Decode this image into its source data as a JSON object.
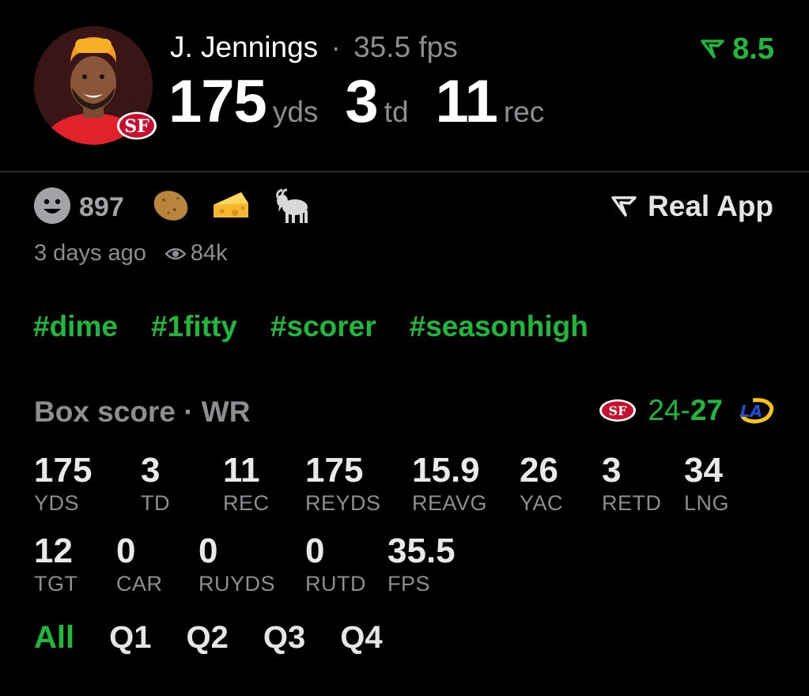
{
  "player": {
    "name": "J. Jennings",
    "separator": "·",
    "fps_text": "35.5 fps",
    "headline": [
      {
        "value": "175",
        "unit": "yds"
      },
      {
        "value": "3",
        "unit": "td"
      },
      {
        "value": "11",
        "unit": "rec"
      }
    ],
    "team_logo_text": "SF"
  },
  "rating": {
    "value": "8.5",
    "color": "#1fb83b"
  },
  "reactions": {
    "count": "897",
    "emojis": [
      "smiley-face-icon",
      "potato-icon",
      "cheese-icon",
      "goat-icon"
    ]
  },
  "source": {
    "label": "Real App"
  },
  "meta": {
    "time_ago": "3 days ago",
    "views": "84k"
  },
  "hashtags": [
    "#dime",
    "#1fitty",
    "#scorer",
    "#seasonhigh"
  ],
  "box_score": {
    "title": "Box score · WR",
    "home_logo_text": "SF",
    "away_logo_text": "LA",
    "score_left": "24-",
    "score_right": "27",
    "stats_row1": [
      {
        "value": "175",
        "label": "YDS"
      },
      {
        "value": "3",
        "label": "TD"
      },
      {
        "value": "11",
        "label": "REC"
      },
      {
        "value": "175",
        "label": "REYDS"
      },
      {
        "value": "15.9",
        "label": "REAVG"
      },
      {
        "value": "26",
        "label": "YAC"
      },
      {
        "value": "3",
        "label": "RETD"
      },
      {
        "value": "34",
        "label": "LNG"
      }
    ],
    "stats_row2": [
      {
        "value": "12",
        "label": "TGT"
      },
      {
        "value": "0",
        "label": "CAR"
      },
      {
        "value": "0",
        "label": "RUYDS"
      },
      {
        "value": "0",
        "label": "RUTD"
      },
      {
        "value": "35.5",
        "label": "FPS"
      }
    ]
  },
  "quarters": {
    "items": [
      "All",
      "Q1",
      "Q2",
      "Q3",
      "Q4"
    ],
    "active": "All"
  },
  "colors": {
    "accent": "#1fb83b",
    "muted": "#8d8d92",
    "background": "#000000"
  }
}
